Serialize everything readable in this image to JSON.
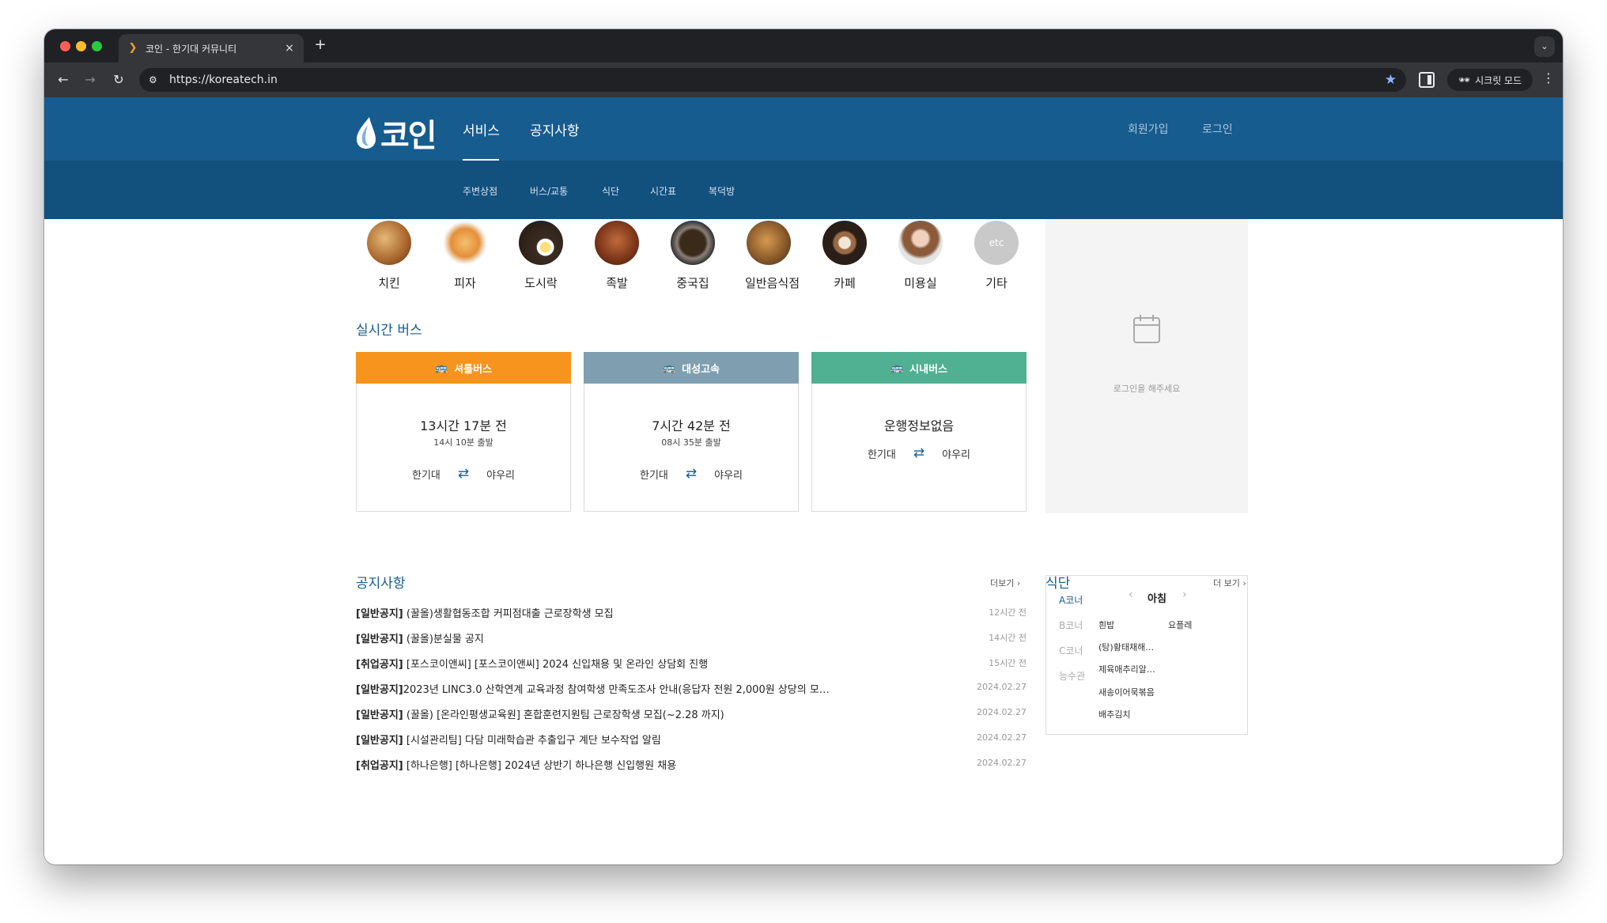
{
  "browser": {
    "tab_title": "코인 - 한기대 커뮤니티",
    "url": "https://koreatech.in",
    "incognito_label": "시크릿 모드"
  },
  "header": {
    "logo_text": "코인",
    "menu": [
      "서비스",
      "공지사항"
    ],
    "right": [
      "회원가입",
      "로그인"
    ],
    "submenu": [
      "주변상점",
      "버스/교통",
      "식단",
      "시간표",
      "복덕방"
    ]
  },
  "categories": [
    {
      "label": "치킨",
      "icon": "chicken-icon"
    },
    {
      "label": "피자",
      "icon": "pizza-icon"
    },
    {
      "label": "도시락",
      "icon": "lunchbox-icon"
    },
    {
      "label": "족발",
      "icon": "jokbal-icon"
    },
    {
      "label": "중국집",
      "icon": "chinese-food-icon"
    },
    {
      "label": "일반음식점",
      "icon": "restaurant-icon"
    },
    {
      "label": "카페",
      "icon": "cafe-icon"
    },
    {
      "label": "미용실",
      "icon": "hair-salon-icon"
    },
    {
      "label": "기타",
      "icon": "etc-icon",
      "badge": "etc"
    }
  ],
  "bus": {
    "title": "실시간 버스",
    "cards": [
      {
        "name": "셔틀버스",
        "color": "#f7941d",
        "time": "13시간 17분 전",
        "depart": "14시 10분 출발",
        "from": "한기대",
        "to": "야우리"
      },
      {
        "name": "대성고속",
        "color": "#7f9fb1",
        "time": "7시간 42분 전",
        "depart": "08시 35분 출발",
        "from": "한기대",
        "to": "야우리"
      },
      {
        "name": "시내버스",
        "color": "#4fb092",
        "time": "운행정보없음",
        "depart": "",
        "from": "한기대",
        "to": "야우리"
      }
    ]
  },
  "login_box": {
    "message": "로그인을 해주세요"
  },
  "notices": {
    "title": "공지사항",
    "more": "더보기",
    "items": [
      {
        "tag": "[일반공지]",
        "text": " (꿀올)생활협동조합 커피점대출 근로장학생 모집",
        "time": "12시간 전"
      },
      {
        "tag": "[일반공지]",
        "text": " (꿀올)분실물 공지",
        "time": "14시간 전"
      },
      {
        "tag": "[취업공지]",
        "text": " [포스코이앤씨] [포스코이앤씨] 2024 신입채용 및 온라인 상담회 진행",
        "time": "15시간 전"
      },
      {
        "tag": "[일반공지]",
        "text": "2023년 LINC3.0 산학연계 교육과정 참여학생 만족도조사 안내(응답자 전원 2,000원 상당의 모…",
        "time": "2024.02.27"
      },
      {
        "tag": "[일반공지]",
        "text": " (꿀올) [온라인평생교육원] 혼합훈련지원팀 근로장학생 모집(~2.28 까지)",
        "time": "2024.02.27"
      },
      {
        "tag": "[일반공지]",
        "text": " [시설관리팀] 다담 미래학습관 추출입구 계단 보수작업 알림",
        "time": "2024.02.27"
      },
      {
        "tag": "[취업공지]",
        "text": " [하나은행] [하나은행] 2024년 상반기 하나은행 신입행원 채용",
        "time": "2024.02.27"
      }
    ]
  },
  "meal": {
    "title": "식단",
    "more": "더 보기",
    "time": "아침",
    "corners": [
      "A코너",
      "B코너",
      "C코너",
      "능수관"
    ],
    "menu_left": [
      "흰밥",
      "(탕)황태채해…",
      "제육애추리알…",
      "새송이어묵볶음",
      "배추김치"
    ],
    "menu_right": [
      "요플레"
    ]
  },
  "colors": {
    "header_blue": "#175c8e",
    "subnav_blue": "#12507e",
    "shuttle_orange": "#f7941d",
    "express_gray": "#7f9fb1",
    "city_green": "#4fb092"
  }
}
